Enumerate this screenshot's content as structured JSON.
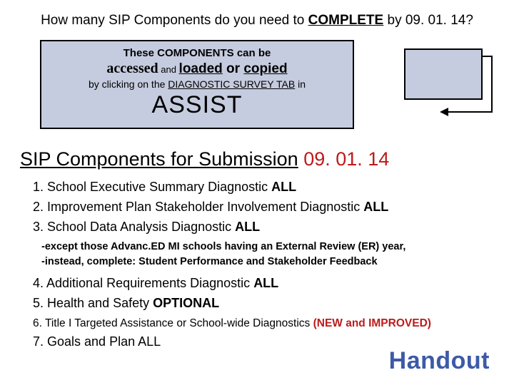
{
  "title": {
    "prefix": "How many SIP Components do you need to ",
    "complete": "COMPLETE",
    "suffix": " by 09. 01. 14?"
  },
  "callout": {
    "line1": "These COMPONENTS can be",
    "accessed": "accessed",
    "and": " and ",
    "loaded": "loaded",
    "or": " or ",
    "copied": "copied",
    "line3_prefix": "by clicking on the ",
    "line3_tab": "DIAGNOSTIC SURVEY TAB",
    "line3_suffix": "  in",
    "assist": "ASSIST"
  },
  "section": {
    "heading": "SIP Components for Submission",
    "date": " 09. 01. 14"
  },
  "items": {
    "i1a": "1. School Executive Summary Diagnostic ",
    "i1b": "ALL",
    "i2a": "2. Improvement Plan Stakeholder Involvement Diagnostic  ",
    "i2b": "ALL",
    "i3a": "3. School Data Analysis Diagnostic ",
    "i3b": "ALL",
    "note1": "-except those Advanc.ED MI schools having an External Review (ER) year,",
    "note2": "-instead, complete: Student Performance and Stakeholder Feedback",
    "i4a": "4. Additional Requirements Diagnostic ",
    "i4b": "ALL",
    "i5a": "5. Health and Safety ",
    "i5b": "OPTIONAL",
    "i6a": "6. Title I Targeted Assistance or School-wide Diagnostics ",
    "i6b": "(NEW and IMPROVED)",
    "i7": "7. Goals and Plan ALL"
  },
  "handout": "Handout"
}
